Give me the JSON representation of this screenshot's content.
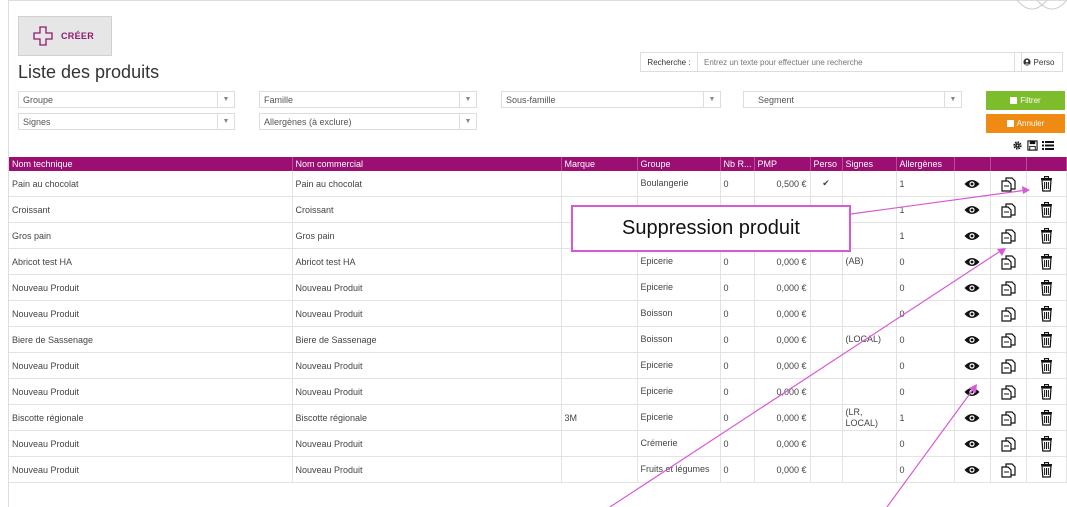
{
  "toolbar": {
    "create_label": "CRÉER"
  },
  "page": {
    "title": "Liste des produits"
  },
  "search": {
    "label": "Recherche :",
    "placeholder": "Entrez un texte pour effectuer une recherche",
    "perso_label": "Perso"
  },
  "filters": {
    "groupe": "Groupe",
    "famille": "Famille",
    "sous_famille": "Sous-famille",
    "segment": "Segment",
    "signes": "Signes",
    "allergenes": "Allergènes (à exclure)",
    "filter_label": "Filtrer",
    "cancel_label": "Annuler"
  },
  "table": {
    "columns": [
      "Nom technique",
      "Nom commercial",
      "Marque",
      "Groupe",
      "Nb R...",
      "PMP",
      "Perso",
      "Signes",
      "Allergènes"
    ],
    "rows": [
      {
        "tech": "Pain au chocolat",
        "comm": "Pain au chocolat",
        "marque": "",
        "groupe": "Boulangerie",
        "nb": "0",
        "pmp": "0,500 €",
        "perso": "✔",
        "signes": "",
        "allerg": "1"
      },
      {
        "tech": "Croissant",
        "comm": "Croissant",
        "marque": "",
        "groupe": "",
        "nb": "",
        "pmp": "",
        "perso": "",
        "signes": "",
        "allerg": "1"
      },
      {
        "tech": "Gros pain",
        "comm": "Gros pain",
        "marque": "",
        "groupe": "",
        "nb": "",
        "pmp": "",
        "perso": "",
        "signes": "",
        "allerg": "1"
      },
      {
        "tech": "Abricot test HA",
        "comm": "Abricot test HA",
        "marque": "",
        "groupe": "Epicerie",
        "nb": "0",
        "pmp": "0,000 €",
        "perso": "",
        "signes": "(AB)",
        "allerg": "0"
      },
      {
        "tech": "Nouveau Produit",
        "comm": "Nouveau Produit",
        "marque": "",
        "groupe": "Epicerie",
        "nb": "0",
        "pmp": "0,000 €",
        "perso": "",
        "signes": "",
        "allerg": "0"
      },
      {
        "tech": "Nouveau Produit",
        "comm": "Nouveau Produit",
        "marque": "",
        "groupe": "Boisson",
        "nb": "0",
        "pmp": "0,000 €",
        "perso": "",
        "signes": "",
        "allerg": "0"
      },
      {
        "tech": "Biere de Sassenage",
        "comm": "Biere de Sassenage",
        "marque": "",
        "groupe": "Boisson",
        "nb": "0",
        "pmp": "0,000 €",
        "perso": "",
        "signes": "(LOCAL)",
        "allerg": "0"
      },
      {
        "tech": "Nouveau Produit",
        "comm": "Nouveau Produit",
        "marque": "",
        "groupe": "Epicerie",
        "nb": "0",
        "pmp": "0,000 €",
        "perso": "",
        "signes": "",
        "allerg": "0"
      },
      {
        "tech": "Nouveau Produit",
        "comm": "Nouveau Produit",
        "marque": "",
        "groupe": "Epicerie",
        "nb": "0",
        "pmp": "0,000 €",
        "perso": "",
        "signes": "",
        "allerg": "0"
      },
      {
        "tech": "Biscotte régionale",
        "comm": "Biscotte régionale",
        "marque": "3M",
        "groupe": "Epicerie",
        "nb": "0",
        "pmp": "0,000 €",
        "perso": "",
        "signes": "(LR, LOCAL)",
        "allerg": "1"
      },
      {
        "tech": "Nouveau Produit",
        "comm": "Nouveau Produit",
        "marque": "",
        "groupe": "Crémerie",
        "nb": "0",
        "pmp": "0,000 €",
        "perso": "",
        "signes": "",
        "allerg": "0"
      },
      {
        "tech": "Nouveau Produit",
        "comm": "Nouveau Produit",
        "marque": "",
        "groupe": "Fruits et légumes",
        "nb": "0",
        "pmp": "0,000 €",
        "perso": "",
        "signes": "",
        "allerg": "0"
      }
    ]
  },
  "callout": {
    "text": "Suppression produit"
  },
  "icons": {
    "create": "plus-icon",
    "view": "eye-icon",
    "duplicate": "duplicate-icon",
    "delete": "trash-icon",
    "settings": "gear-icon",
    "save": "save-icon",
    "list": "list-icon"
  },
  "colors": {
    "header_bg": "#9b0e72",
    "filter_green": "#7dbd2b",
    "cancel_orange": "#ef8a12",
    "callout_border": "#d65ad6"
  }
}
